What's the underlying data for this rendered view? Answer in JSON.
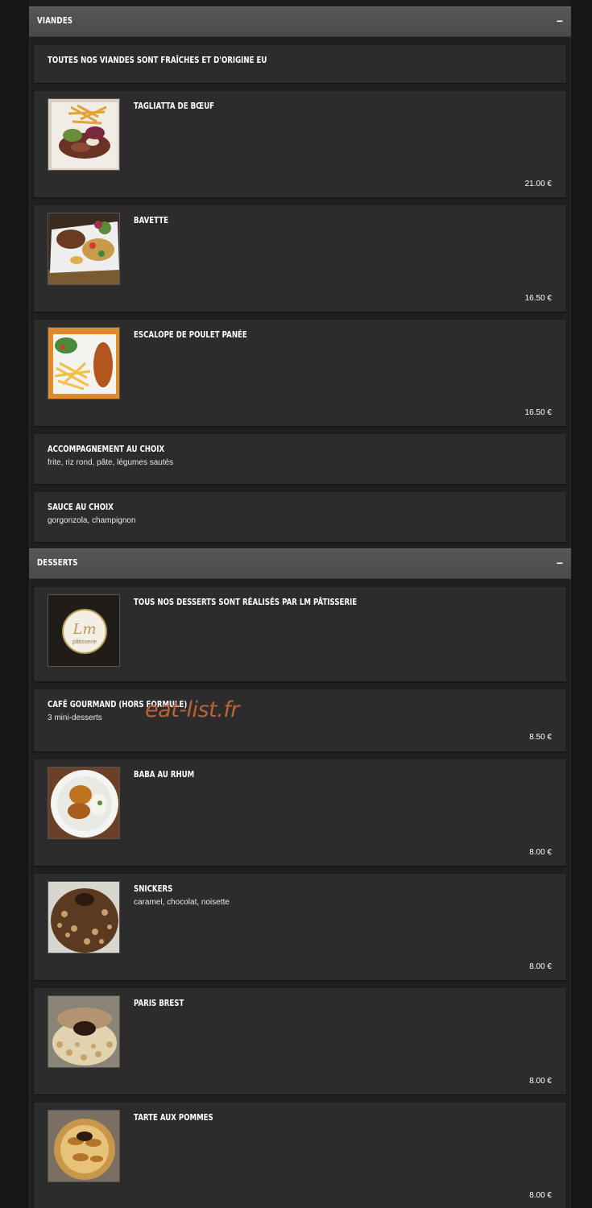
{
  "sections": [
    {
      "title": "VIANDES",
      "toggle": "−",
      "items": [
        {
          "name": "TOUTES NOS VIANDES SONT FRAÎCHES ET D'ORIGINE EU"
        },
        {
          "name": "TAGLIATTA DE BŒUF",
          "price": "21.00 €",
          "image": "tagliata-photo"
        },
        {
          "name": "BAVETTE",
          "price": "16.50 €",
          "image": "bavette-photo"
        },
        {
          "name": "ESCALOPE DE POULET PANÉE",
          "price": "16.50 €",
          "image": "escalope-photo"
        },
        {
          "name": "ACCOMPAGNEMENT AU CHOIX",
          "description": "frite, riz rond, pâte, légumes sautés"
        },
        {
          "name": "SAUCE AU CHOIX",
          "description": "gorgonzola, champignon"
        }
      ]
    },
    {
      "title": "DESSERTS",
      "toggle": "−",
      "items": [
        {
          "name": "TOUS NOS DESSERTS SONT RÉALISÉS PAR LM PÂTISSERIE",
          "image": "lm-patisserie-logo",
          "logo_text": "Lm",
          "logo_subtext": "pâtisserie"
        },
        {
          "name": "CAFÉ GOURMAND (HORS FORMULE)",
          "description": "3 mini-desserts",
          "price": "8.50 €"
        },
        {
          "name": "BABA AU RHUM",
          "price": "8.00 €",
          "image": "baba-photo"
        },
        {
          "name": "SNICKERS",
          "description": "caramel, chocolat, noisette",
          "price": "8.00 €",
          "image": "snickers-photo"
        },
        {
          "name": "PARIS BREST",
          "price": "8.00 €",
          "image": "paris-brest-photo"
        },
        {
          "name": "TARTE AUX POMMES",
          "price": "8.00 €",
          "image": "tarte-photo"
        }
      ]
    }
  ],
  "watermark": "eat-list.fr",
  "colors": {
    "page_bg": "#161616",
    "card_bg": "#2c2c2c",
    "header_bg": "#505050",
    "watermark": "#b8633a"
  }
}
